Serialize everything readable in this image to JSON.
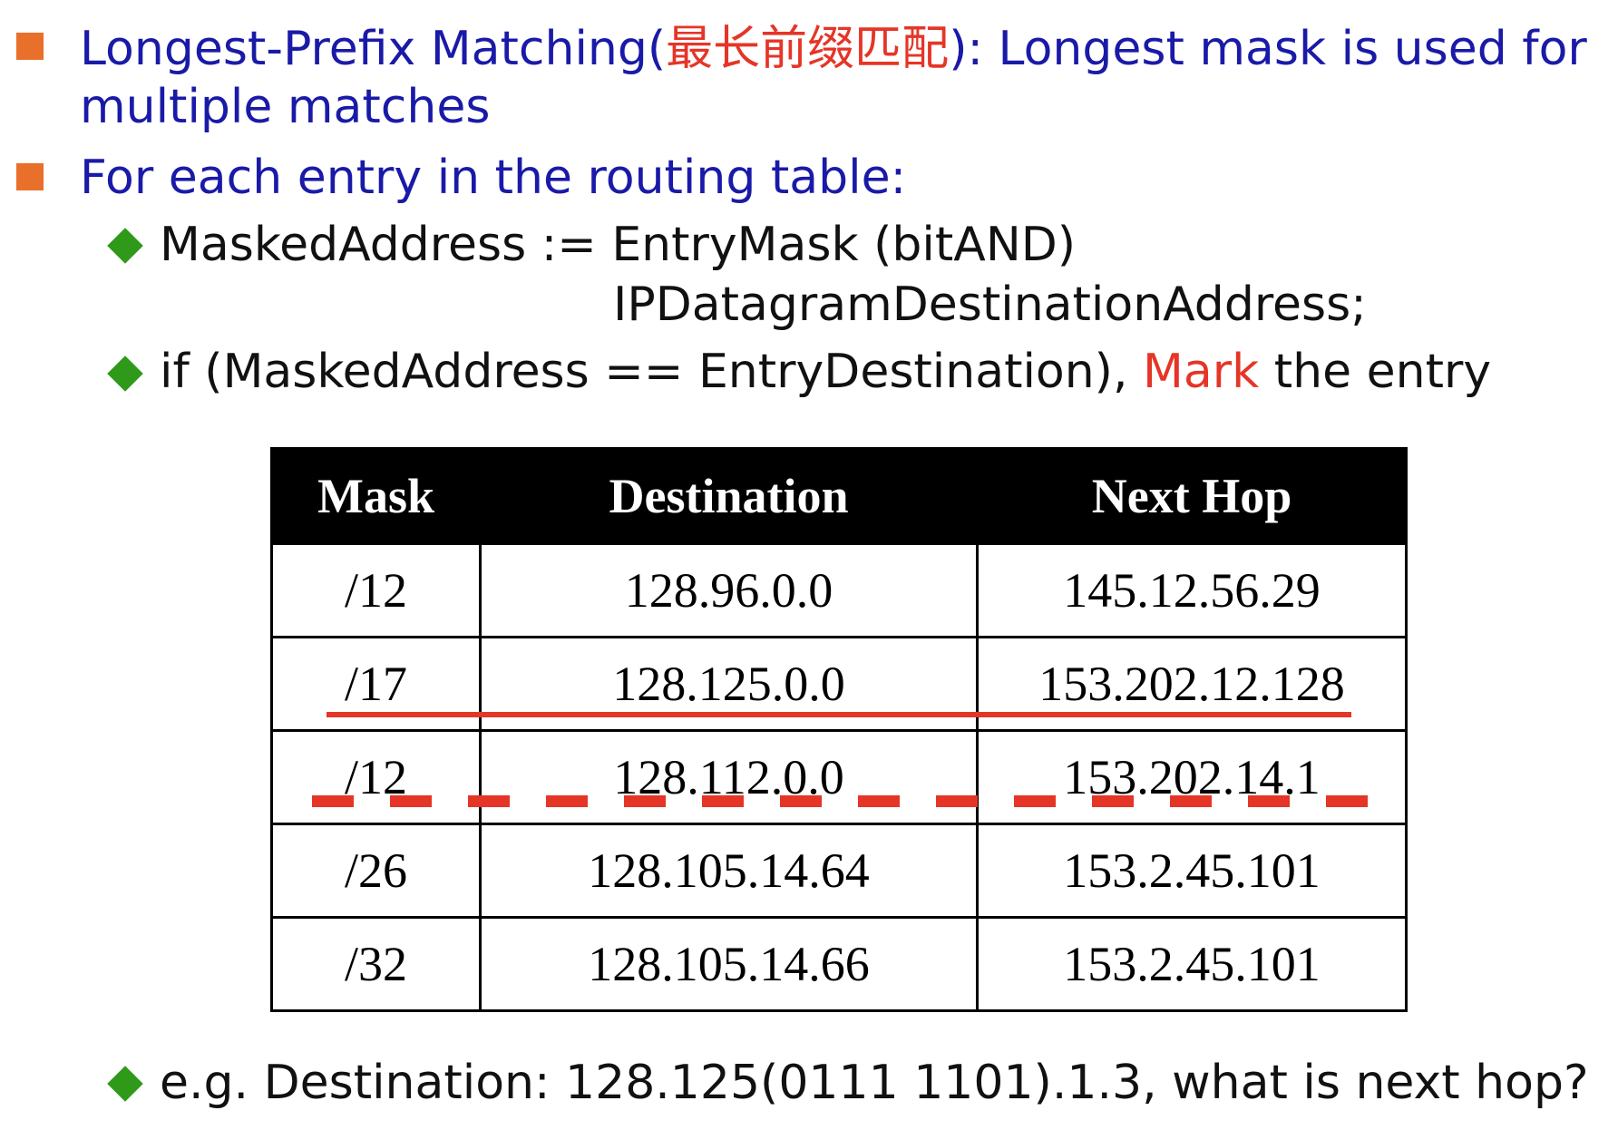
{
  "bullets": [
    {
      "part1": "Longest-Prefix Matching(",
      "cjk": "最长前缀匹配",
      "part2": "): Longest mask is used for",
      "line2": "multiple matches"
    },
    {
      "text": "For each entry in the routing table:"
    }
  ],
  "sub_bullets": {
    "masked_line1": "MaskedAddress := EntryMask (bitAND)",
    "masked_line2": "IPDatagramDestinationAddress;",
    "if_part1": "if (MaskedAddress == EntryDestination), ",
    "if_mark": "Mark",
    "if_part2": " the entry",
    "example": "e.g. Destination: 128.125(0111 1101).1.3, what is next hop?"
  },
  "table": {
    "headers": [
      "Mask",
      "Destination",
      "Next Hop"
    ],
    "rows": [
      [
        "/12",
        "128.96.0.0",
        "145.12.56.29"
      ],
      [
        "/17",
        "128.125.0.0",
        "153.202.12.128"
      ],
      [
        "/12",
        "128.112.0.0",
        "153.202.14.1"
      ],
      [
        "/26",
        "128.105.14.64",
        "153.2.45.101"
      ],
      [
        "/32",
        "128.105.14.66",
        "153.2.45.101"
      ]
    ]
  },
  "colors": {
    "bullet": "#e8702a",
    "diamond": "#2f9a1a",
    "blue_text": "#1a1aa8",
    "highlight": "#e53527"
  }
}
